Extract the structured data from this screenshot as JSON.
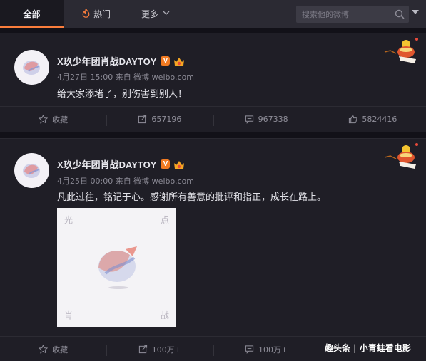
{
  "nav": {
    "tabs": [
      {
        "label": "全部",
        "icon": ""
      },
      {
        "label": "热门",
        "icon": "flame-icon"
      },
      {
        "label": "更多",
        "icon": "chevron-down-icon"
      }
    ],
    "search_placeholder": "搜索他的微博",
    "accent": "#fa7d3c"
  },
  "posts": [
    {
      "author": "X玖少年团肖战DAYTOY",
      "verified_badge": "V",
      "meta": "4月27日 15:00 来自 微博 weibo.com",
      "text": "给大家添堵了，别伤害到别人！",
      "actions": {
        "favorite": "收藏",
        "repost": "657196",
        "comment": "967338",
        "like": "5824416"
      }
    },
    {
      "author": "X玖少年团肖战DAYTOY",
      "verified_badge": "V",
      "meta": "4月25日 00:00 来自 微博 weibo.com",
      "text": "凡此过往，铭记于心。感谢所有善意的批评和指正，成长在路上。",
      "image": {
        "corner_top_left": "光",
        "corner_top_right": "点",
        "corner_bottom_left": "肖",
        "corner_bottom_right": "战"
      },
      "actions": {
        "favorite": "收藏",
        "repost": "100万+",
        "comment": "100万+"
      }
    }
  ],
  "watermark": "趣头条 | 小青蛙看电影"
}
